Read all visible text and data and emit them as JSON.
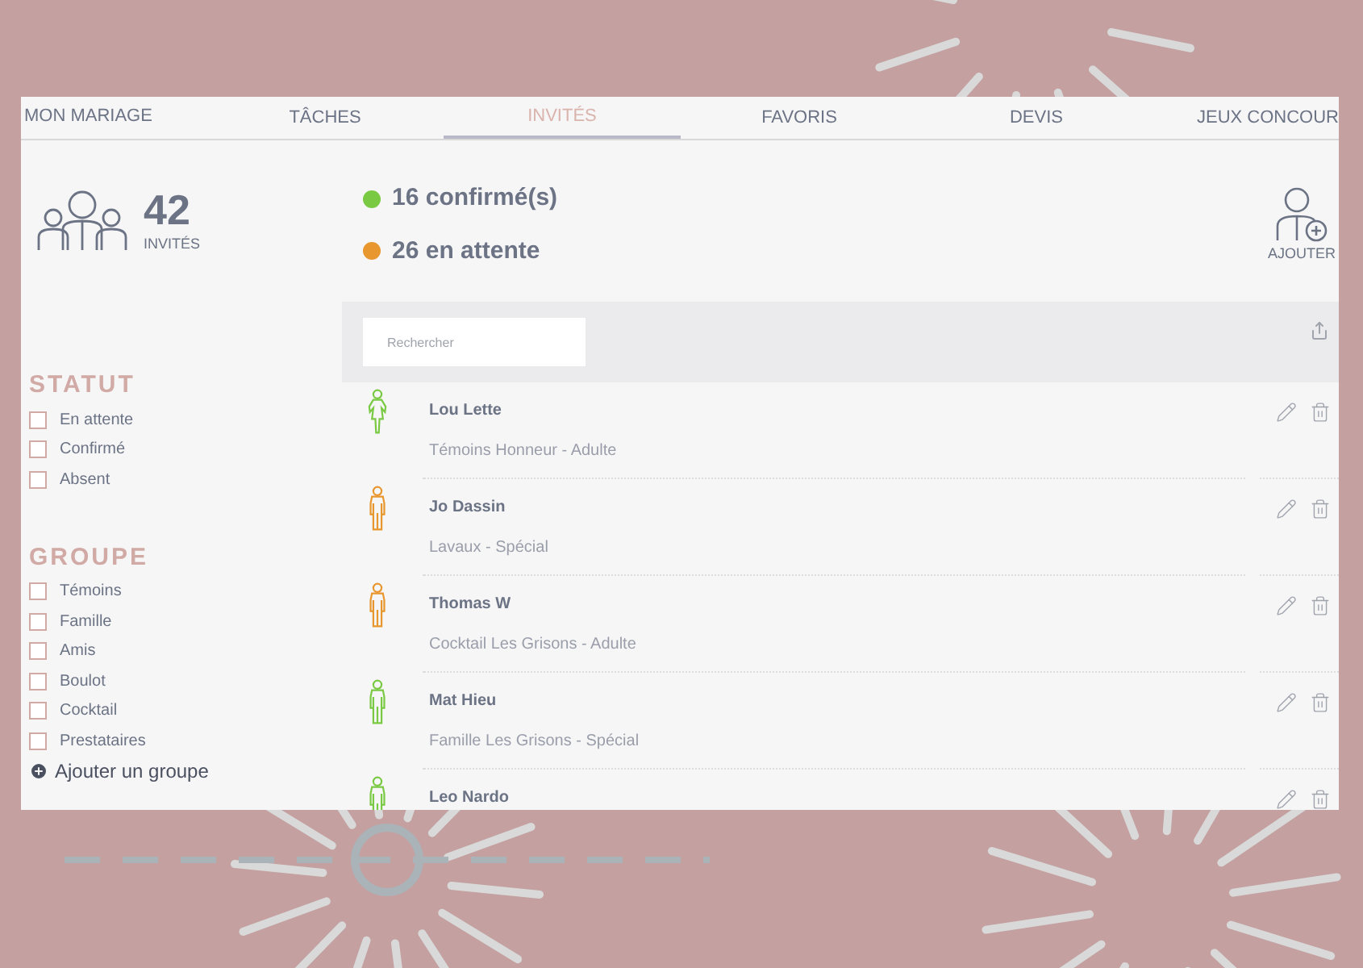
{
  "tabs": [
    {
      "label": "MON MARIAGE",
      "selected": false
    },
    {
      "label": "TÂCHES",
      "selected": false
    },
    {
      "label": "INVITÉS",
      "selected": true
    },
    {
      "label": "FAVORIS",
      "selected": false
    },
    {
      "label": "DEVIS",
      "selected": false
    },
    {
      "label": "JEUX CONCOUR",
      "selected": false
    }
  ],
  "summary": {
    "count": "42",
    "count_label": "INVITÉS",
    "stats": [
      {
        "text": "16 confirmé(s)",
        "color": "#7ac943"
      },
      {
        "text": "26 en attente",
        "color": "#e8962e"
      }
    ],
    "add_label": "AJOUTER"
  },
  "filters": [
    {
      "title": "STATUT",
      "options": [
        {
          "label": "En attente",
          "checked": false
        },
        {
          "label": "Confirmé",
          "checked": false
        },
        {
          "label": "Absent",
          "checked": false
        }
      ]
    },
    {
      "title": "GROUPE",
      "options": [
        {
          "label": "Témoins",
          "checked": false
        },
        {
          "label": "Famille",
          "checked": false
        },
        {
          "label": "Amis",
          "checked": false
        },
        {
          "label": "Boulot",
          "checked": false
        },
        {
          "label": "Cocktail",
          "checked": false
        },
        {
          "label": "Prestataires",
          "checked": false
        }
      ]
    }
  ],
  "add_group": "Ajouter un groupe",
  "search": {
    "placeholder": "Rechercher"
  },
  "guests": [
    {
      "name": "Lou Lette",
      "details": "Témoins Honneur - Adulte",
      "kind": "woman",
      "color": "#7ac943"
    },
    {
      "name": "Jo Dassin",
      "details": "Lavaux - Spécial",
      "kind": "man",
      "color": "#e8962e"
    },
    {
      "name": "Thomas W",
      "details": "Cocktail Les Grisons - Adulte",
      "kind": "man",
      "color": "#e8962e"
    },
    {
      "name": "Mat Hieu",
      "details": "Famille Les Grisons - Spécial",
      "kind": "man",
      "color": "#7ac943"
    },
    {
      "name": "Leo Nardo",
      "kind": "man",
      "color": "#7ac943"
    }
  ]
}
